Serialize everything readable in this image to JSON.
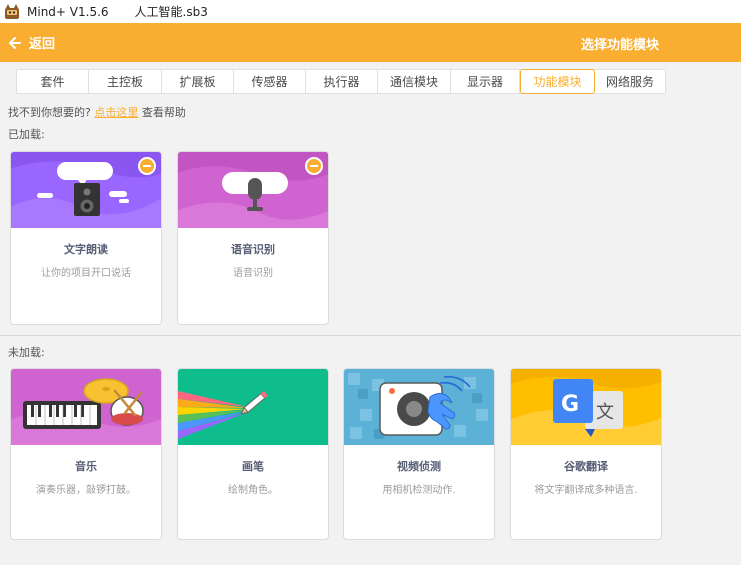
{
  "window": {
    "app_name": "Mind+ V1.5.6",
    "file_name": "人工智能.sb3"
  },
  "header": {
    "back_label": "返回",
    "title": "选择功能模块"
  },
  "tabs": [
    {
      "label": "套件",
      "active": false
    },
    {
      "label": "主控板",
      "active": false
    },
    {
      "label": "扩展板",
      "active": false
    },
    {
      "label": "传感器",
      "active": false
    },
    {
      "label": "执行器",
      "active": false
    },
    {
      "label": "通信模块",
      "active": false
    },
    {
      "label": "显示器",
      "active": false
    },
    {
      "label": "功能模块",
      "active": true
    },
    {
      "label": "网络服务",
      "active": false
    }
  ],
  "help": {
    "prefix": "找不到你想要的?",
    "link": "点击这里",
    "suffix": "查看帮助"
  },
  "loaded": {
    "label": "已加载:",
    "cards": [
      {
        "name": "文字朗读",
        "desc": "让你的项目开口说话",
        "icon": "speaker-icon"
      },
      {
        "name": "语音识别",
        "desc": "语音识别",
        "icon": "microphone-icon"
      }
    ]
  },
  "unloaded": {
    "label": "未加载:",
    "cards": [
      {
        "name": "音乐",
        "desc": "演奏乐器，敲锣打鼓。",
        "icon": "music-instruments-icon"
      },
      {
        "name": "画笔",
        "desc": "绘制角色。",
        "icon": "pen-icon"
      },
      {
        "name": "视频侦测",
        "desc": "用相机检测动作.",
        "icon": "video-sensing-icon"
      },
      {
        "name": "谷歌翻译",
        "desc": "将文字翻译成多种语言.",
        "icon": "translate-icon"
      }
    ]
  },
  "colors": {
    "accent": "#f9ae32",
    "text": "#575e75"
  }
}
